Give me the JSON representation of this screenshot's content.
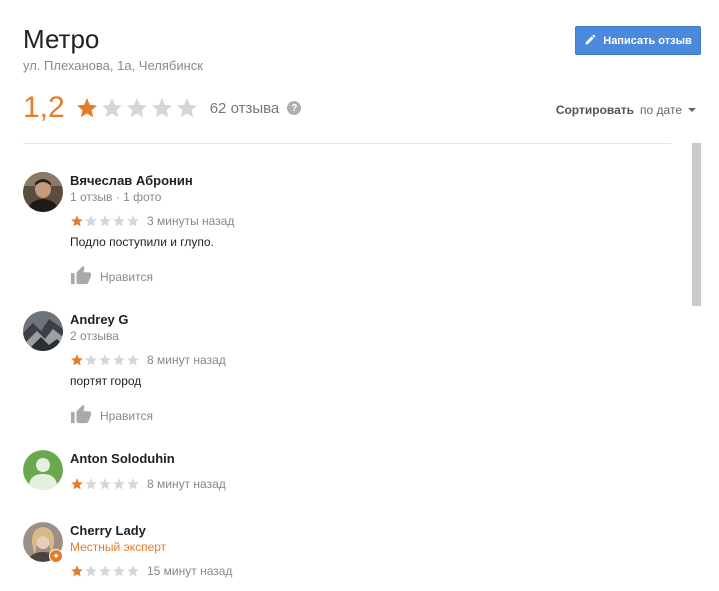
{
  "place": {
    "title": "Метро",
    "address": "ул. Плеханова, 1а, Челябинск"
  },
  "write_button": {
    "label": "Написать отзыв",
    "icon": "pencil-icon"
  },
  "summary": {
    "rating": "1,2",
    "rating_stars_filled": 1,
    "review_count": "62 отзыва",
    "help_icon": "?"
  },
  "sort": {
    "label": "Сортировать",
    "value": "по дате"
  },
  "colors": {
    "accent": "#e37d2c",
    "button": "#4b89dc",
    "star_empty": "#d6d6d6"
  },
  "reviews": [
    {
      "name": "Вячеслав Абронин",
      "meta": "1 отзыв · 1 фото",
      "stars": 1,
      "time": "3 минуты назад",
      "text": "Подло поступили и глупо.",
      "like": "Нравится"
    },
    {
      "name": "Andrey G",
      "meta": "2 отзыва",
      "stars": 1,
      "time": "8 минут назад",
      "text": "портят город",
      "like": "Нравится"
    },
    {
      "name": "Anton Soloduhin",
      "stars": 1,
      "time": "8 минут назад"
    },
    {
      "name": "Cherry Lady",
      "meta": "Местный эксперт",
      "stars": 1,
      "time": "15 минут назад"
    }
  ]
}
